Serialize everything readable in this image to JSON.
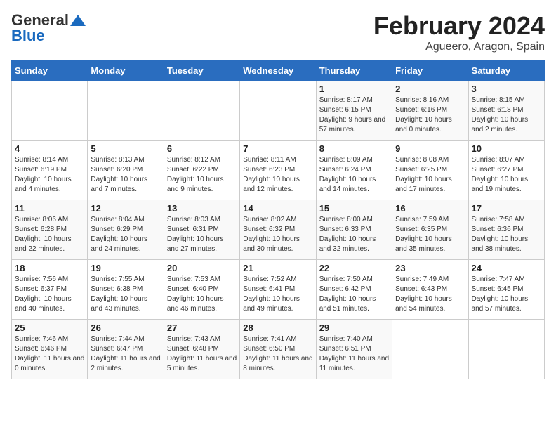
{
  "header": {
    "logo_general": "General",
    "logo_blue": "Blue",
    "title": "February 2024",
    "subtitle": "Agueero, Aragon, Spain"
  },
  "weekdays": [
    "Sunday",
    "Monday",
    "Tuesday",
    "Wednesday",
    "Thursday",
    "Friday",
    "Saturday"
  ],
  "weeks": [
    [
      {
        "day": "",
        "detail": ""
      },
      {
        "day": "",
        "detail": ""
      },
      {
        "day": "",
        "detail": ""
      },
      {
        "day": "",
        "detail": ""
      },
      {
        "day": "1",
        "detail": "Sunrise: 8:17 AM\nSunset: 6:15 PM\nDaylight: 9 hours and 57 minutes."
      },
      {
        "day": "2",
        "detail": "Sunrise: 8:16 AM\nSunset: 6:16 PM\nDaylight: 10 hours and 0 minutes."
      },
      {
        "day": "3",
        "detail": "Sunrise: 8:15 AM\nSunset: 6:18 PM\nDaylight: 10 hours and 2 minutes."
      }
    ],
    [
      {
        "day": "4",
        "detail": "Sunrise: 8:14 AM\nSunset: 6:19 PM\nDaylight: 10 hours and 4 minutes."
      },
      {
        "day": "5",
        "detail": "Sunrise: 8:13 AM\nSunset: 6:20 PM\nDaylight: 10 hours and 7 minutes."
      },
      {
        "day": "6",
        "detail": "Sunrise: 8:12 AM\nSunset: 6:22 PM\nDaylight: 10 hours and 9 minutes."
      },
      {
        "day": "7",
        "detail": "Sunrise: 8:11 AM\nSunset: 6:23 PM\nDaylight: 10 hours and 12 minutes."
      },
      {
        "day": "8",
        "detail": "Sunrise: 8:09 AM\nSunset: 6:24 PM\nDaylight: 10 hours and 14 minutes."
      },
      {
        "day": "9",
        "detail": "Sunrise: 8:08 AM\nSunset: 6:25 PM\nDaylight: 10 hours and 17 minutes."
      },
      {
        "day": "10",
        "detail": "Sunrise: 8:07 AM\nSunset: 6:27 PM\nDaylight: 10 hours and 19 minutes."
      }
    ],
    [
      {
        "day": "11",
        "detail": "Sunrise: 8:06 AM\nSunset: 6:28 PM\nDaylight: 10 hours and 22 minutes."
      },
      {
        "day": "12",
        "detail": "Sunrise: 8:04 AM\nSunset: 6:29 PM\nDaylight: 10 hours and 24 minutes."
      },
      {
        "day": "13",
        "detail": "Sunrise: 8:03 AM\nSunset: 6:31 PM\nDaylight: 10 hours and 27 minutes."
      },
      {
        "day": "14",
        "detail": "Sunrise: 8:02 AM\nSunset: 6:32 PM\nDaylight: 10 hours and 30 minutes."
      },
      {
        "day": "15",
        "detail": "Sunrise: 8:00 AM\nSunset: 6:33 PM\nDaylight: 10 hours and 32 minutes."
      },
      {
        "day": "16",
        "detail": "Sunrise: 7:59 AM\nSunset: 6:35 PM\nDaylight: 10 hours and 35 minutes."
      },
      {
        "day": "17",
        "detail": "Sunrise: 7:58 AM\nSunset: 6:36 PM\nDaylight: 10 hours and 38 minutes."
      }
    ],
    [
      {
        "day": "18",
        "detail": "Sunrise: 7:56 AM\nSunset: 6:37 PM\nDaylight: 10 hours and 40 minutes."
      },
      {
        "day": "19",
        "detail": "Sunrise: 7:55 AM\nSunset: 6:38 PM\nDaylight: 10 hours and 43 minutes."
      },
      {
        "day": "20",
        "detail": "Sunrise: 7:53 AM\nSunset: 6:40 PM\nDaylight: 10 hours and 46 minutes."
      },
      {
        "day": "21",
        "detail": "Sunrise: 7:52 AM\nSunset: 6:41 PM\nDaylight: 10 hours and 49 minutes."
      },
      {
        "day": "22",
        "detail": "Sunrise: 7:50 AM\nSunset: 6:42 PM\nDaylight: 10 hours and 51 minutes."
      },
      {
        "day": "23",
        "detail": "Sunrise: 7:49 AM\nSunset: 6:43 PM\nDaylight: 10 hours and 54 minutes."
      },
      {
        "day": "24",
        "detail": "Sunrise: 7:47 AM\nSunset: 6:45 PM\nDaylight: 10 hours and 57 minutes."
      }
    ],
    [
      {
        "day": "25",
        "detail": "Sunrise: 7:46 AM\nSunset: 6:46 PM\nDaylight: 11 hours and 0 minutes."
      },
      {
        "day": "26",
        "detail": "Sunrise: 7:44 AM\nSunset: 6:47 PM\nDaylight: 11 hours and 2 minutes."
      },
      {
        "day": "27",
        "detail": "Sunrise: 7:43 AM\nSunset: 6:48 PM\nDaylight: 11 hours and 5 minutes."
      },
      {
        "day": "28",
        "detail": "Sunrise: 7:41 AM\nSunset: 6:50 PM\nDaylight: 11 hours and 8 minutes."
      },
      {
        "day": "29",
        "detail": "Sunrise: 7:40 AM\nSunset: 6:51 PM\nDaylight: 11 hours and 11 minutes."
      },
      {
        "day": "",
        "detail": ""
      },
      {
        "day": "",
        "detail": ""
      }
    ]
  ]
}
